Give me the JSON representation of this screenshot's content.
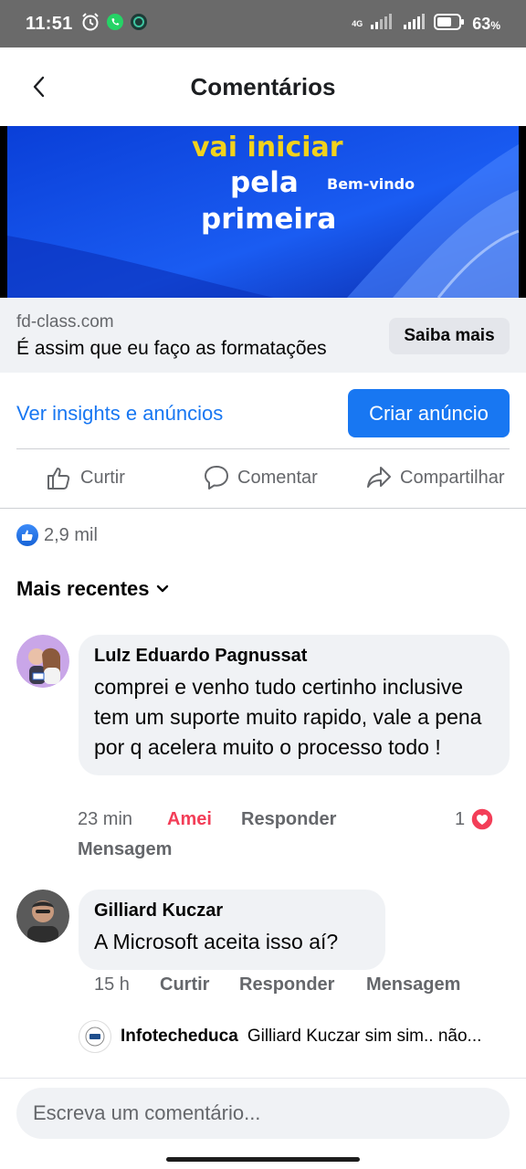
{
  "status_bar": {
    "time": "11:51",
    "network": "4G",
    "battery": "63",
    "battery_unit": "%"
  },
  "header": {
    "title": "Comentários"
  },
  "ad": {
    "image_text": {
      "line1": "vai iniciar",
      "line2": "pela",
      "line3": "primeira",
      "welcome": "Bem-vindo"
    },
    "domain": "fd-class.com",
    "headline": "É assim que eu faço as formatações",
    "cta": "Saiba mais"
  },
  "insights": {
    "link": "Ver insights e anúncios",
    "create_button": "Criar anúncio"
  },
  "actions": {
    "like": "Curtir",
    "comment": "Comentar",
    "share": "Compartilhar"
  },
  "reactions": {
    "count": "2,9 mil"
  },
  "sort": {
    "label": "Mais recentes"
  },
  "comments": [
    {
      "author": "LuIz Eduardo Pagnussat",
      "text": "comprei e venho tudo certinho inclusive tem um suporte muito rapido, vale a pena por q acelera muito o processo todo !",
      "time": "23 min",
      "reaction_label": "Amei",
      "reply": "Responder",
      "message": "Mensagem",
      "reaction_count": "1"
    },
    {
      "author": "Gilliard Kuczar",
      "text": "A Microsoft aceita isso aí?",
      "time": "15 h",
      "like": "Curtir",
      "reply": "Responder",
      "message": "Mensagem",
      "reply_preview": {
        "author": "Infotecheduca",
        "text": "Gilliard Kuczar sim sim.. não..."
      }
    }
  ],
  "compose": {
    "placeholder": "Escreva um comentário..."
  },
  "colors": {
    "accent": "#1877f2",
    "love": "#f33e58",
    "bubble": "#f0f2f5",
    "secondary_text": "#65676b"
  }
}
